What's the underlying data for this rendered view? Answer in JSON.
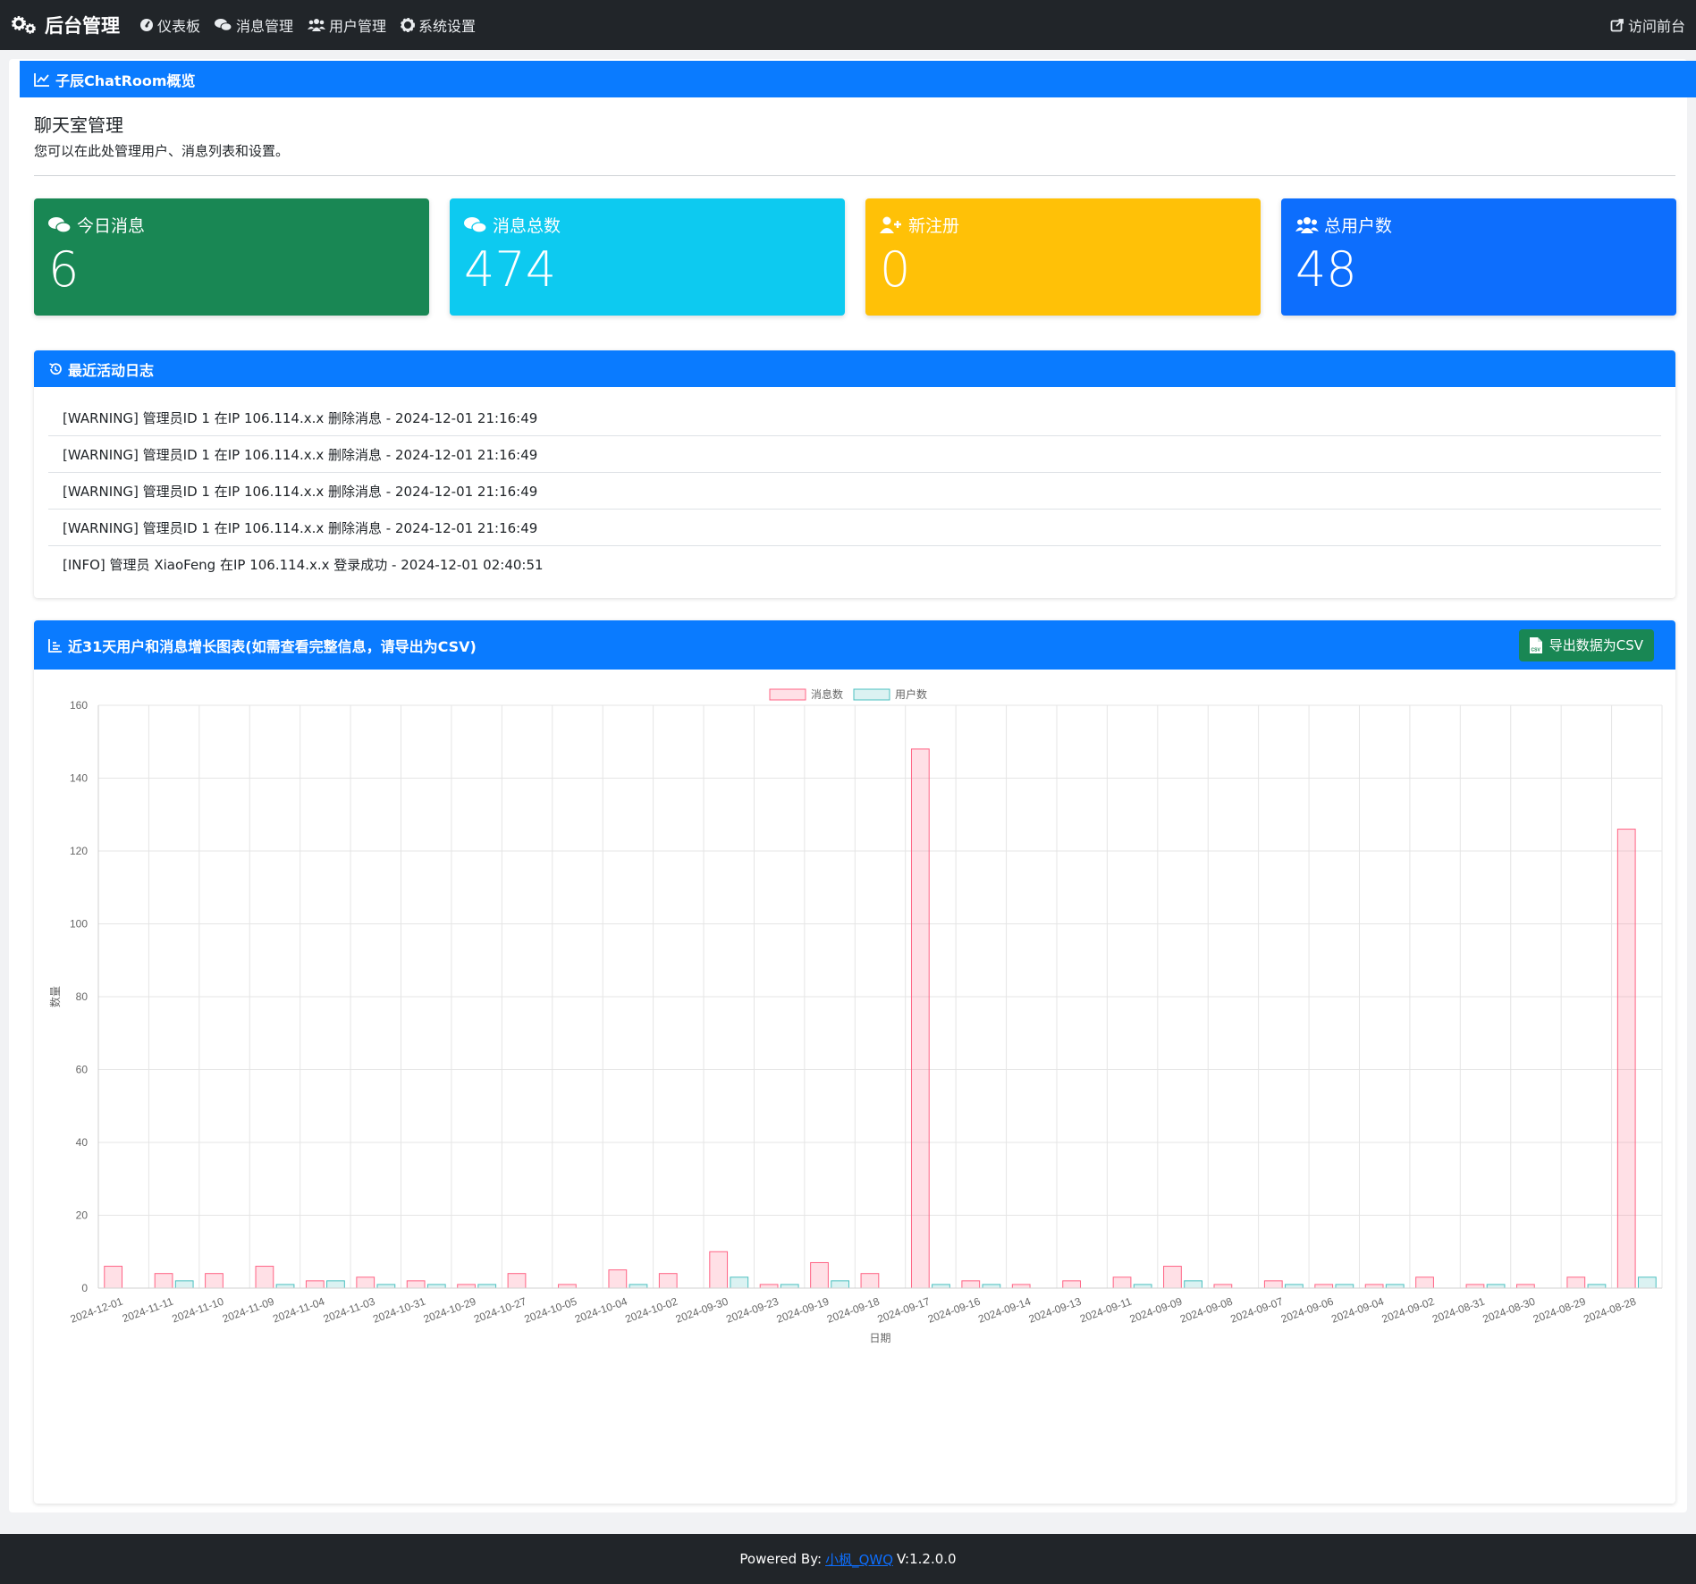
{
  "nav": {
    "brand": "后台管理",
    "items": [
      {
        "label": "仪表板"
      },
      {
        "label": "消息管理"
      },
      {
        "label": "用户管理"
      },
      {
        "label": "系统设置"
      }
    ],
    "right": "访问前台"
  },
  "overview": {
    "header": "子辰ChatRoom概览",
    "title": "聊天室管理",
    "subtitle": "您可以在此处管理用户、消息列表和设置。"
  },
  "stats": [
    {
      "label": "今日消息",
      "value": "6",
      "color": "#198754",
      "icon": "comments-icon"
    },
    {
      "label": "消息总数",
      "value": "474",
      "color": "#0dcaf0",
      "icon": "comments-icon"
    },
    {
      "label": "新注册",
      "value": "0",
      "color": "#ffc107",
      "icon": "user-plus-icon"
    },
    {
      "label": "总用户数",
      "value": "48",
      "color": "#0d6efd",
      "icon": "users-icon"
    }
  ],
  "activity": {
    "header": "最近活动日志",
    "logs": [
      "[WARNING] 管理员ID 1 在IP 106.114.x.x 删除消息 - 2024-12-01 21:16:49",
      "[WARNING] 管理员ID 1 在IP 106.114.x.x 删除消息 - 2024-12-01 21:16:49",
      "[WARNING] 管理员ID 1 在IP 106.114.x.x 删除消息 - 2024-12-01 21:16:49",
      "[WARNING] 管理员ID 1 在IP 106.114.x.x 删除消息 - 2024-12-01 21:16:49",
      "[INFO] 管理员 XiaoFeng 在IP 106.114.x.x 登录成功 - 2024-12-01 02:40:51"
    ]
  },
  "chart_panel": {
    "header": "近31天用户和消息增长图表(如需查看完整信息，请导出为CSV)",
    "export_label": "导出数据为CSV"
  },
  "chart_data": {
    "type": "bar",
    "xlabel": "日期",
    "ylabel": "数量",
    "ylim": [
      0,
      160
    ],
    "yticks": [
      0,
      20,
      40,
      60,
      80,
      100,
      120,
      140,
      160
    ],
    "grid": true,
    "legend_position": "top-center",
    "categories": [
      "2024-12-01",
      "2024-11-11",
      "2024-11-10",
      "2024-11-09",
      "2024-11-04",
      "2024-11-03",
      "2024-10-31",
      "2024-10-29",
      "2024-10-27",
      "2024-10-05",
      "2024-10-04",
      "2024-10-02",
      "2024-09-30",
      "2024-09-23",
      "2024-09-19",
      "2024-09-18",
      "2024-09-17",
      "2024-09-16",
      "2024-09-14",
      "2024-09-13",
      "2024-09-11",
      "2024-09-09",
      "2024-09-08",
      "2024-09-07",
      "2024-09-06",
      "2024-09-04",
      "2024-09-02",
      "2024-08-31",
      "2024-08-30",
      "2024-08-29",
      "2024-08-28"
    ],
    "series": [
      {
        "name": "消息数",
        "color": "#ff6384",
        "values": [
          6,
          4,
          4,
          6,
          2,
          3,
          2,
          1,
          4,
          1,
          5,
          4,
          10,
          1,
          7,
          4,
          148,
          2,
          1,
          2,
          3,
          6,
          1,
          2,
          1,
          1,
          3,
          1,
          1,
          3,
          126
        ]
      },
      {
        "name": "用户数",
        "color": "#4bc0c0",
        "values": [
          0,
          2,
          0,
          1,
          2,
          1,
          1,
          1,
          0,
          0,
          1,
          0,
          3,
          1,
          2,
          0,
          1,
          1,
          0,
          0,
          1,
          2,
          0,
          1,
          1,
          1,
          0,
          1,
          0,
          1,
          3
        ]
      }
    ]
  },
  "footer": {
    "prefix": "Powered By:",
    "link": "小枫_QWQ",
    "version": "V:1.2.0.0"
  }
}
